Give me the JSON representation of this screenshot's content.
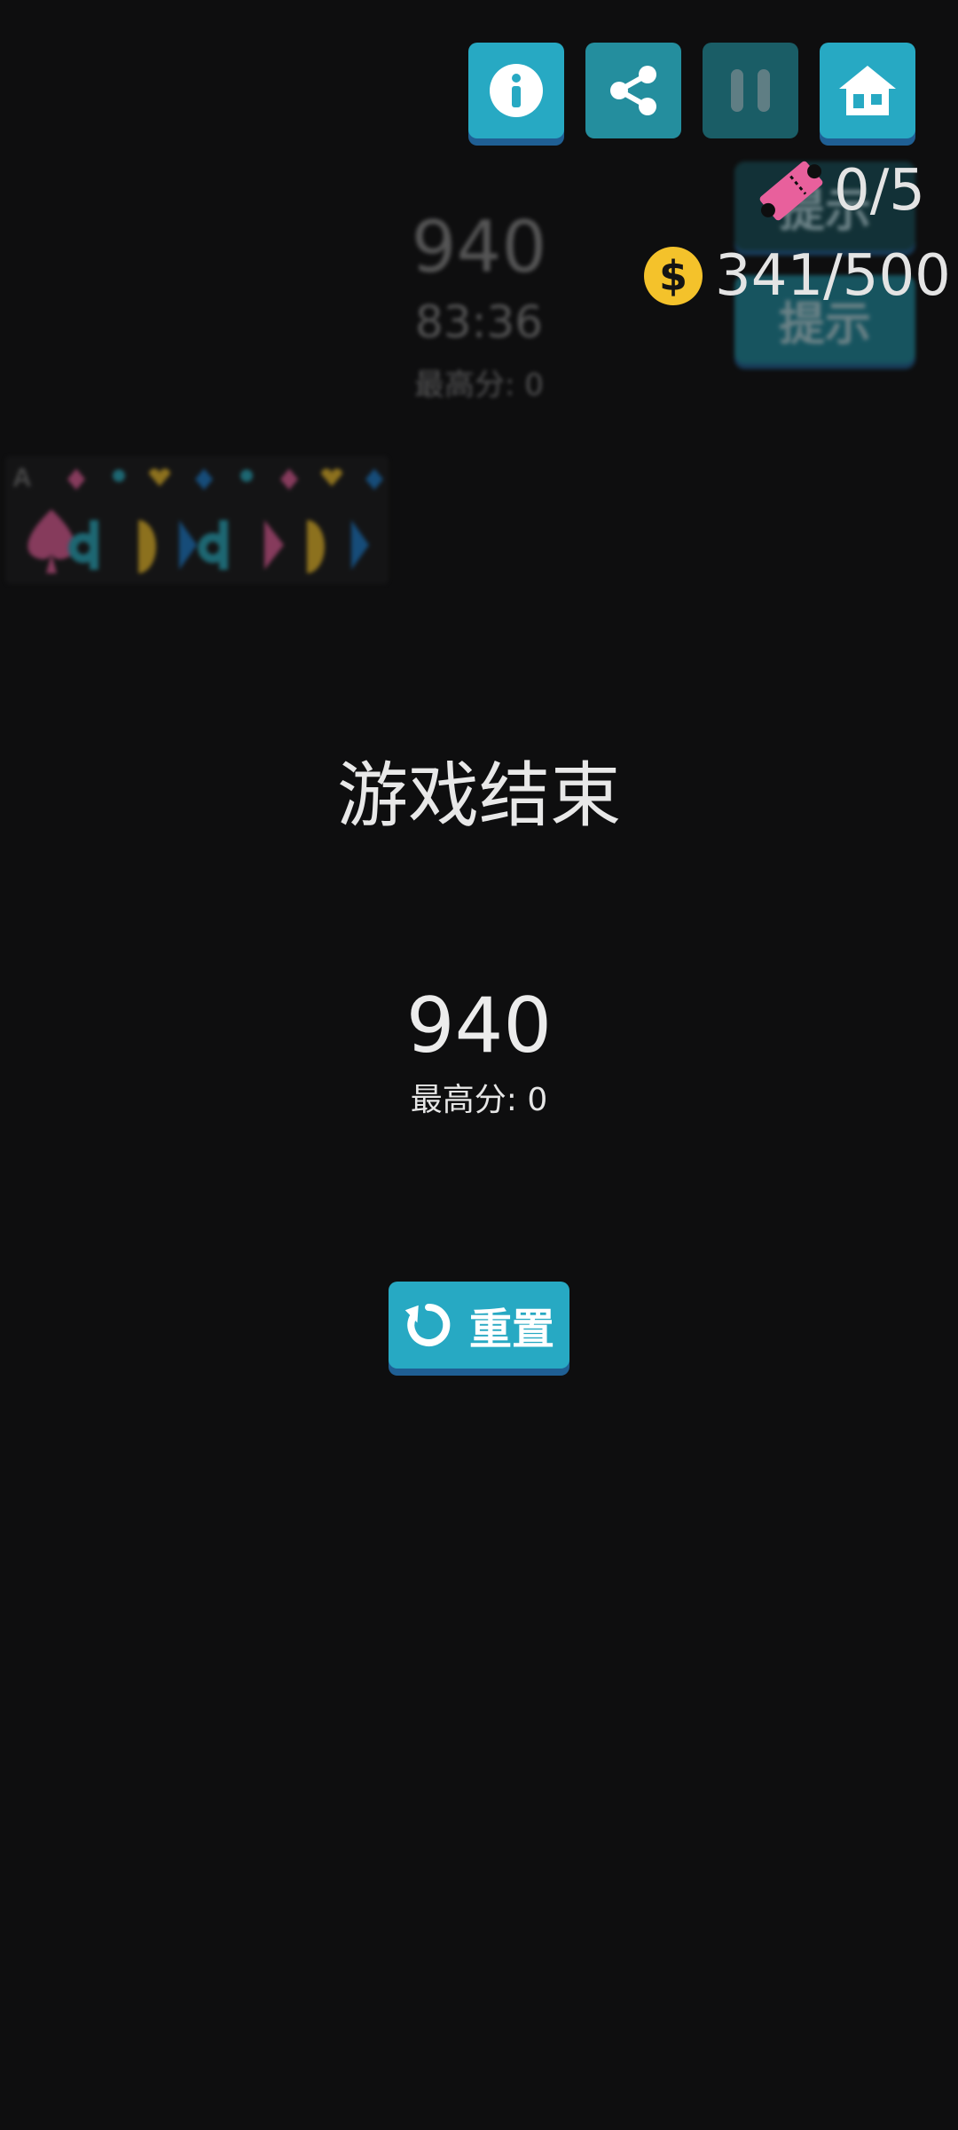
{
  "background_game": {
    "score": "940",
    "time": "83:36",
    "best": "最高分: 0",
    "hint_label": "提示",
    "strip_rank": "A"
  },
  "toolbar": {
    "info_icon": "info-icon",
    "share_icon": "share-icon",
    "pause_icon": "pause-icon",
    "home_icon": "home-icon"
  },
  "resources": {
    "tickets": "0/5",
    "coins": "341/500",
    "coin_symbol": "$"
  },
  "game_over": {
    "title": "游戏结束",
    "score": "940",
    "best": "最高分: 0",
    "reset_label": "重置"
  },
  "colors": {
    "accent": "#27a9c3",
    "accent_shadow": "#1f5f94",
    "ticket_pink": "#e8609c",
    "coin_yellow": "#f4c22b",
    "background": "#0e0e0f"
  }
}
